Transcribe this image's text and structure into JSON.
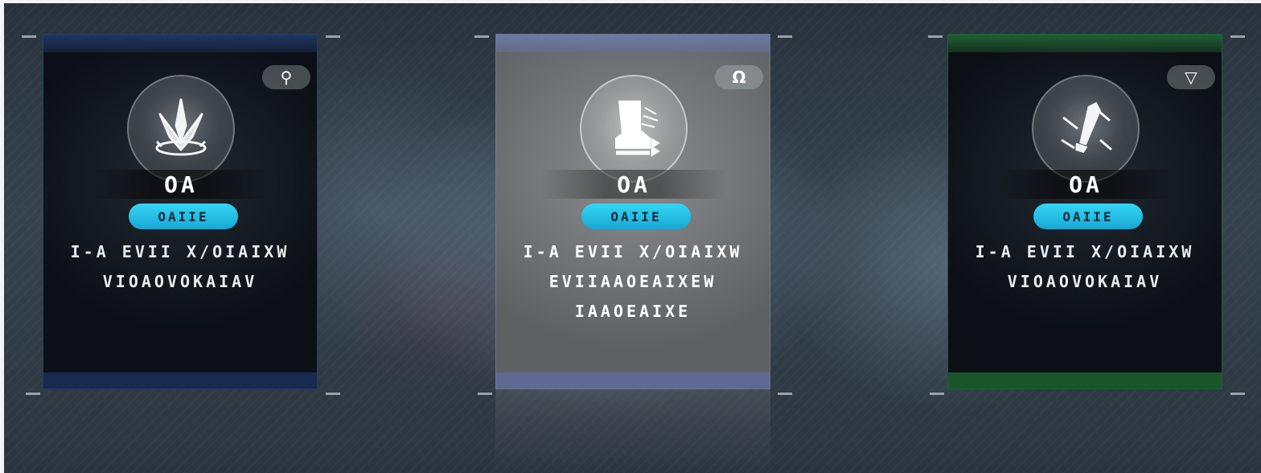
{
  "cards": [
    {
      "id": "card-left",
      "theme": "blue",
      "accent": "#2c4f8f",
      "badge_icon": "figure-icon",
      "badge_glyph": "⚲",
      "emblem_icon": "crown-crest-icon",
      "level": "OA",
      "tag": "OAIIE",
      "description_lines": [
        "I-A EVII X/OIAIXW",
        "VIOAOVOKAIAV"
      ],
      "selected": false
    },
    {
      "id": "card-middle",
      "theme": "grey",
      "accent": "#8a8d8f",
      "badge_icon": "omega-icon",
      "badge_glyph": "Ω",
      "emblem_icon": "speed-boot-icon",
      "level": "OA",
      "tag": "OAIIE",
      "description_lines": [
        "I-A EVII X/OIAIXW",
        "EVIIAAOEAIXEW",
        "IAAOEAIXE"
      ],
      "selected": true
    },
    {
      "id": "card-right",
      "theme": "green",
      "accent": "#2f8a48",
      "badge_icon": "triangle-down-icon",
      "badge_glyph": "▽",
      "emblem_icon": "bullet-icon",
      "level": "OA",
      "tag": "OAIIE",
      "description_lines": [
        "I-A EVII X/OIAIXW",
        "VIOAOVOKAIAV"
      ],
      "selected": false
    }
  ]
}
